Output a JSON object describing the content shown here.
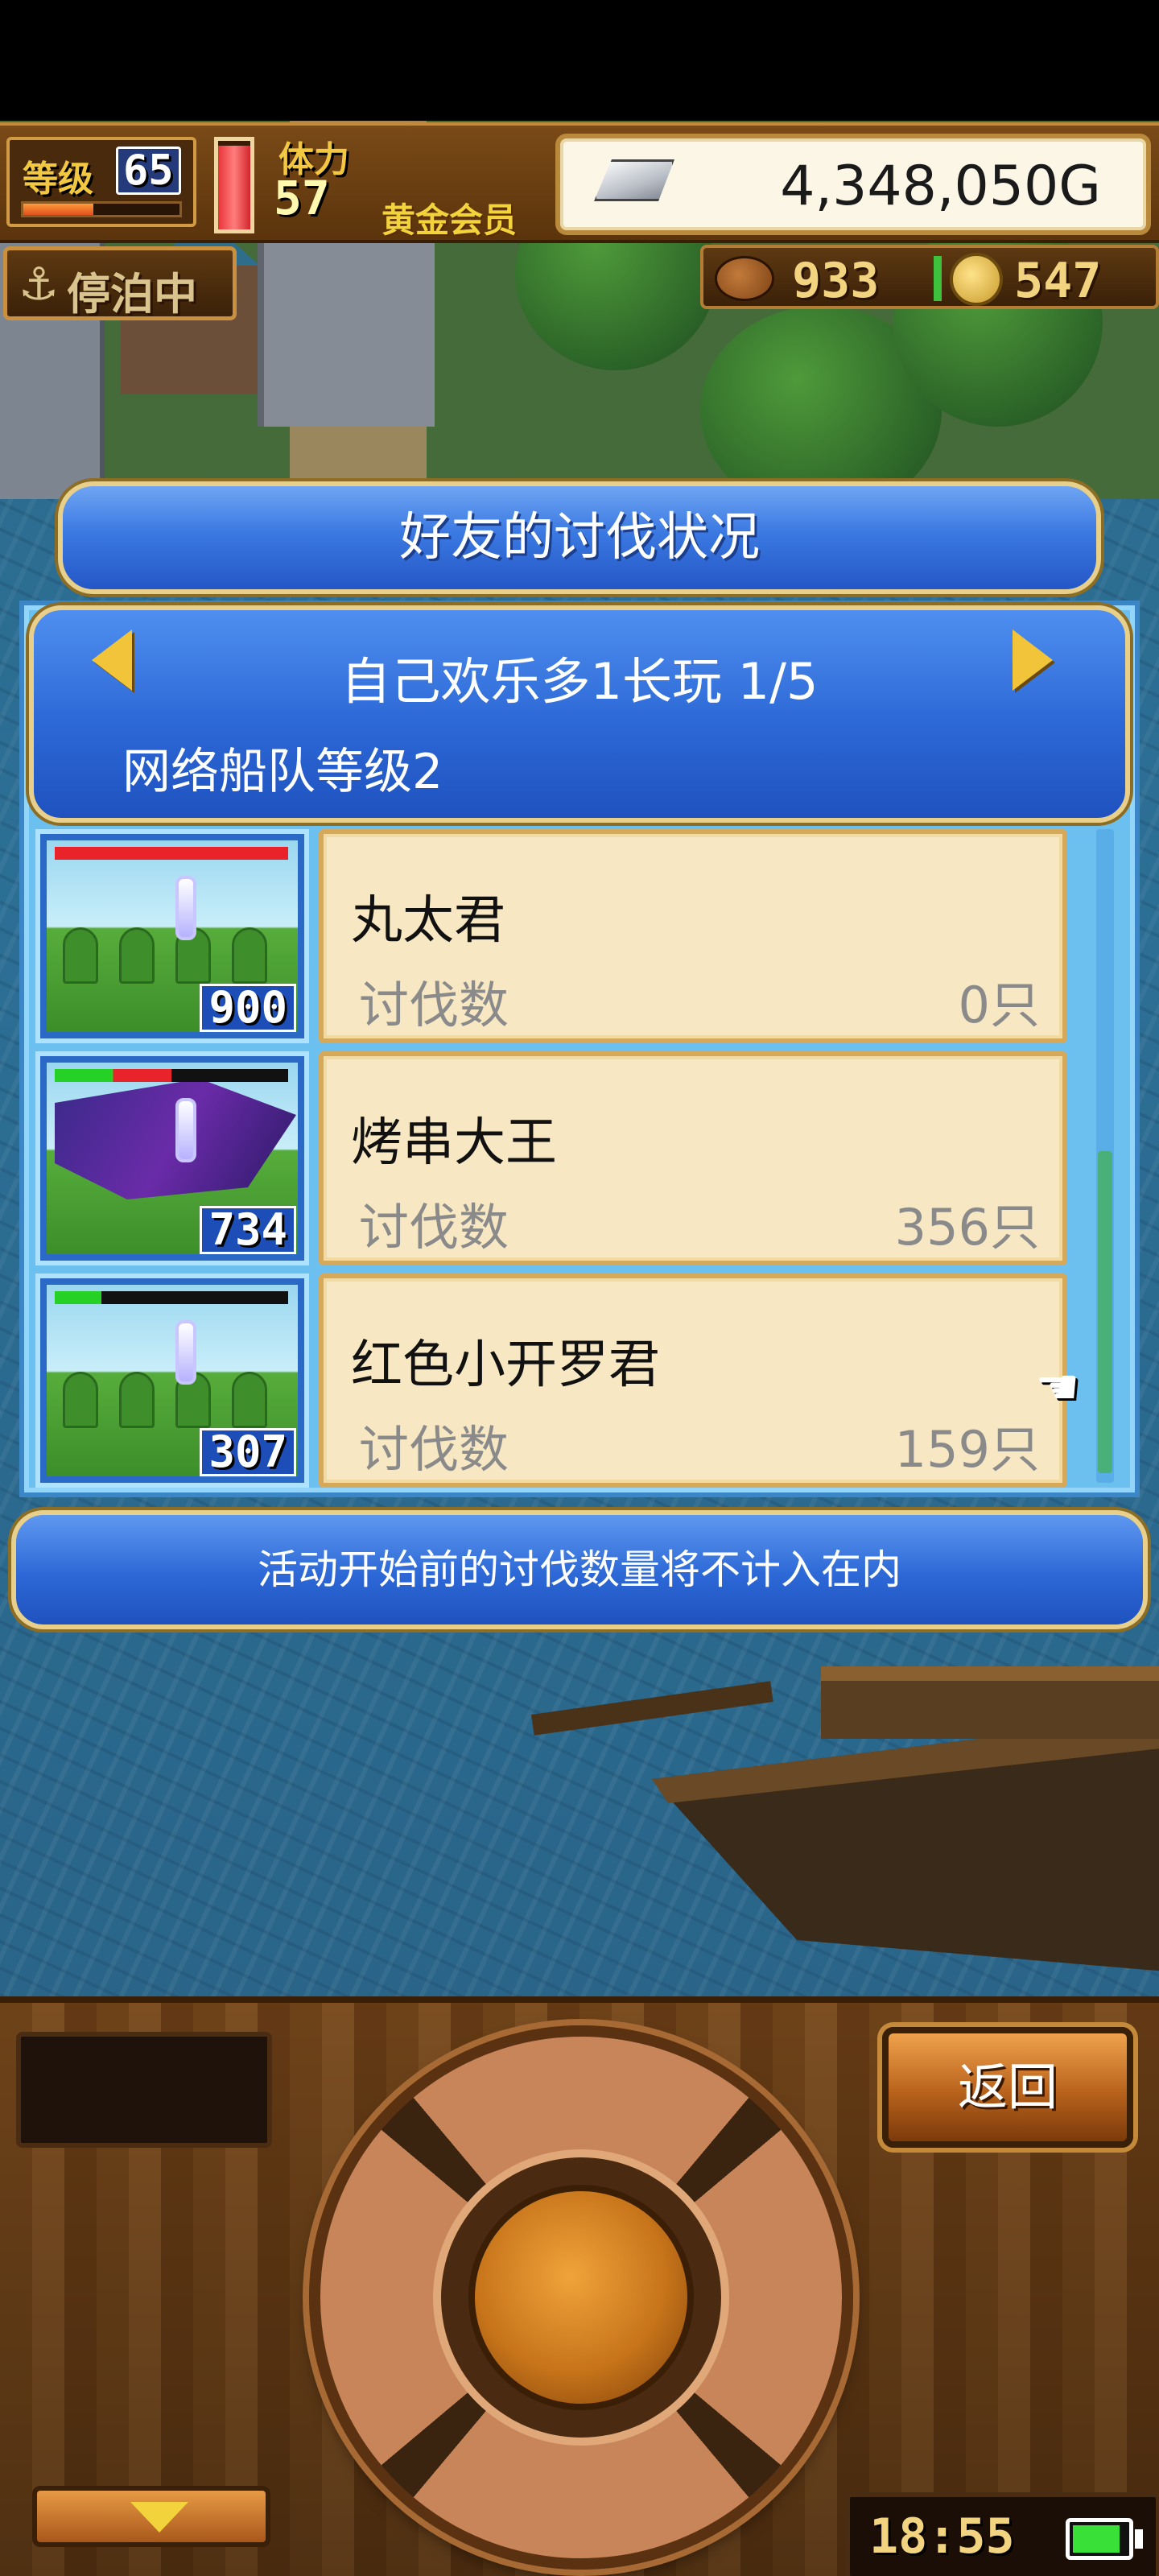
{
  "hud": {
    "level_label": "等级",
    "level_value": "65",
    "exp_fraction": 0.45,
    "stamina_label": "体力",
    "stamina_value": "57",
    "stamina_fraction": 0.95,
    "membership": "黄金会员",
    "gold": "4,348,050G",
    "status": "停泊中",
    "resource_1": "933",
    "resource_2": "547"
  },
  "dialog": {
    "title": "好友的讨伐状况",
    "friend_name": "自己欢乐多1长玩 1/5",
    "fleet_level": "网络船队等级2",
    "rows": [
      {
        "name": "丸太君",
        "label": "讨伐数",
        "count": "0只",
        "badge": "900",
        "hp_fraction": 1.0
      },
      {
        "name": "烤串大王",
        "label": "讨伐数",
        "count": "356只",
        "badge": "734",
        "hp_fraction": 0.5
      },
      {
        "name": "红色小开罗君",
        "label": "讨伐数",
        "count": "159只",
        "badge": "307",
        "hp_fraction": 0.2
      }
    ],
    "note": "活动开始前的讨伐数量将不计入在内"
  },
  "console": {
    "back_label": "返回",
    "time": "18:55",
    "battery_fraction": 0.8
  },
  "colors": {
    "dialog_blue": "#2c68d6",
    "frame_gold": "#e8d08a",
    "card_bg": "#f7e8c3",
    "hp_red": "#e8232a",
    "hp_green": "#26d126"
  },
  "icons": [
    "anchor-icon",
    "silver-ingot-icon",
    "meat-icon",
    "coin-icon",
    "arrow-left-icon",
    "arrow-right-icon",
    "pointing-hand-icon",
    "down-arrow-icon",
    "battery-icon"
  ]
}
